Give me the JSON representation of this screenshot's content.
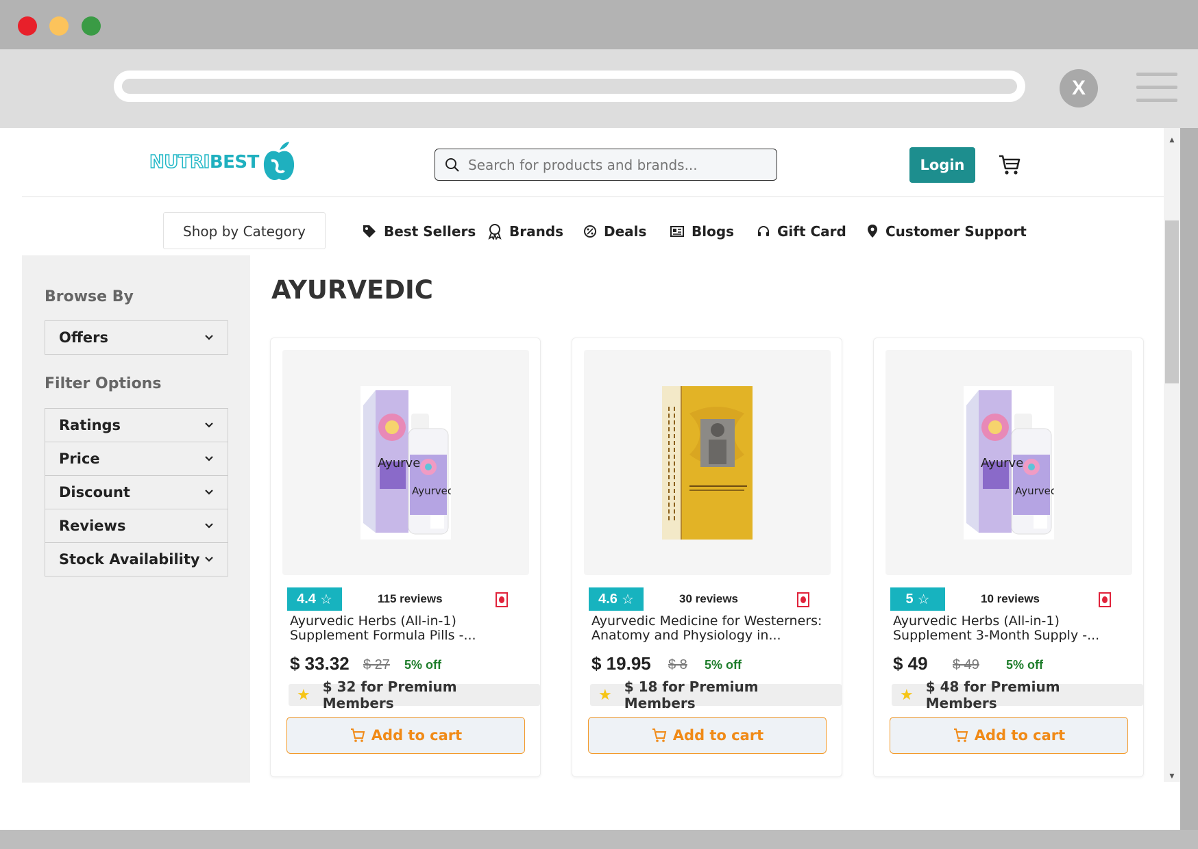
{
  "window": {
    "dots": [
      "#e8202a",
      "#fcc35b",
      "#3a9b45"
    ],
    "close_label": "X"
  },
  "header": {
    "logo_part1": "NUTRI",
    "logo_part2": "BEST",
    "search_placeholder": "Search for products and brands...",
    "login_label": "Login"
  },
  "nav": {
    "shop_by_category": "Shop by Category",
    "items": [
      {
        "label": "Best Sellers",
        "icon": "tag-icon"
      },
      {
        "label": "Brands",
        "icon": "award-icon"
      },
      {
        "label": "Deals",
        "icon": "discount-icon"
      },
      {
        "label": "Blogs",
        "icon": "newspaper-icon"
      },
      {
        "label": "Gift Card",
        "icon": "headset-icon"
      },
      {
        "label": "Customer Support",
        "icon": "location-pin-icon"
      }
    ]
  },
  "sidebar": {
    "browse_by": "Browse By",
    "offers_label": "Offers",
    "filter_options": "Filter Options",
    "filters": [
      "Ratings",
      "Price",
      "Discount",
      "Reviews",
      "Stock Availability"
    ]
  },
  "main": {
    "title": "AYURVEDIC",
    "products": [
      {
        "rating": "4.4",
        "reviews": "115 reviews",
        "name": "Ayurvedic Herbs (All-in-1) Supplement Formula Pills -...",
        "price": "$ 33.32",
        "mrp": "$ 27",
        "discount": "5% off",
        "premium": "$ 32 for Premium Members",
        "add_to_cart": "Add to cart"
      },
      {
        "rating": "4.6",
        "reviews": "30 reviews",
        "name": "Ayurvedic Medicine for Westerners: Anatomy and Physiology in...",
        "price": "$ 19.95",
        "mrp": "$ 8",
        "discount": "5% off",
        "premium": "$ 18 for Premium Members",
        "add_to_cart": "Add to cart"
      },
      {
        "rating": "5",
        "reviews": "10 reviews",
        "name": "Ayurvedic Herbs (All-in-1) Supplement 3-Month Supply -...",
        "price": "$ 49",
        "mrp": "$ 49",
        "discount": "5% off",
        "premium": "$ 48 for Premium Members",
        "add_to_cart": "Add to cart"
      }
    ]
  },
  "colors": {
    "brand_teal": "#1d8e8e",
    "rating_teal": "#17b3bf",
    "cart_orange": "#f08a17",
    "discount_green": "#1e7d2b"
  }
}
